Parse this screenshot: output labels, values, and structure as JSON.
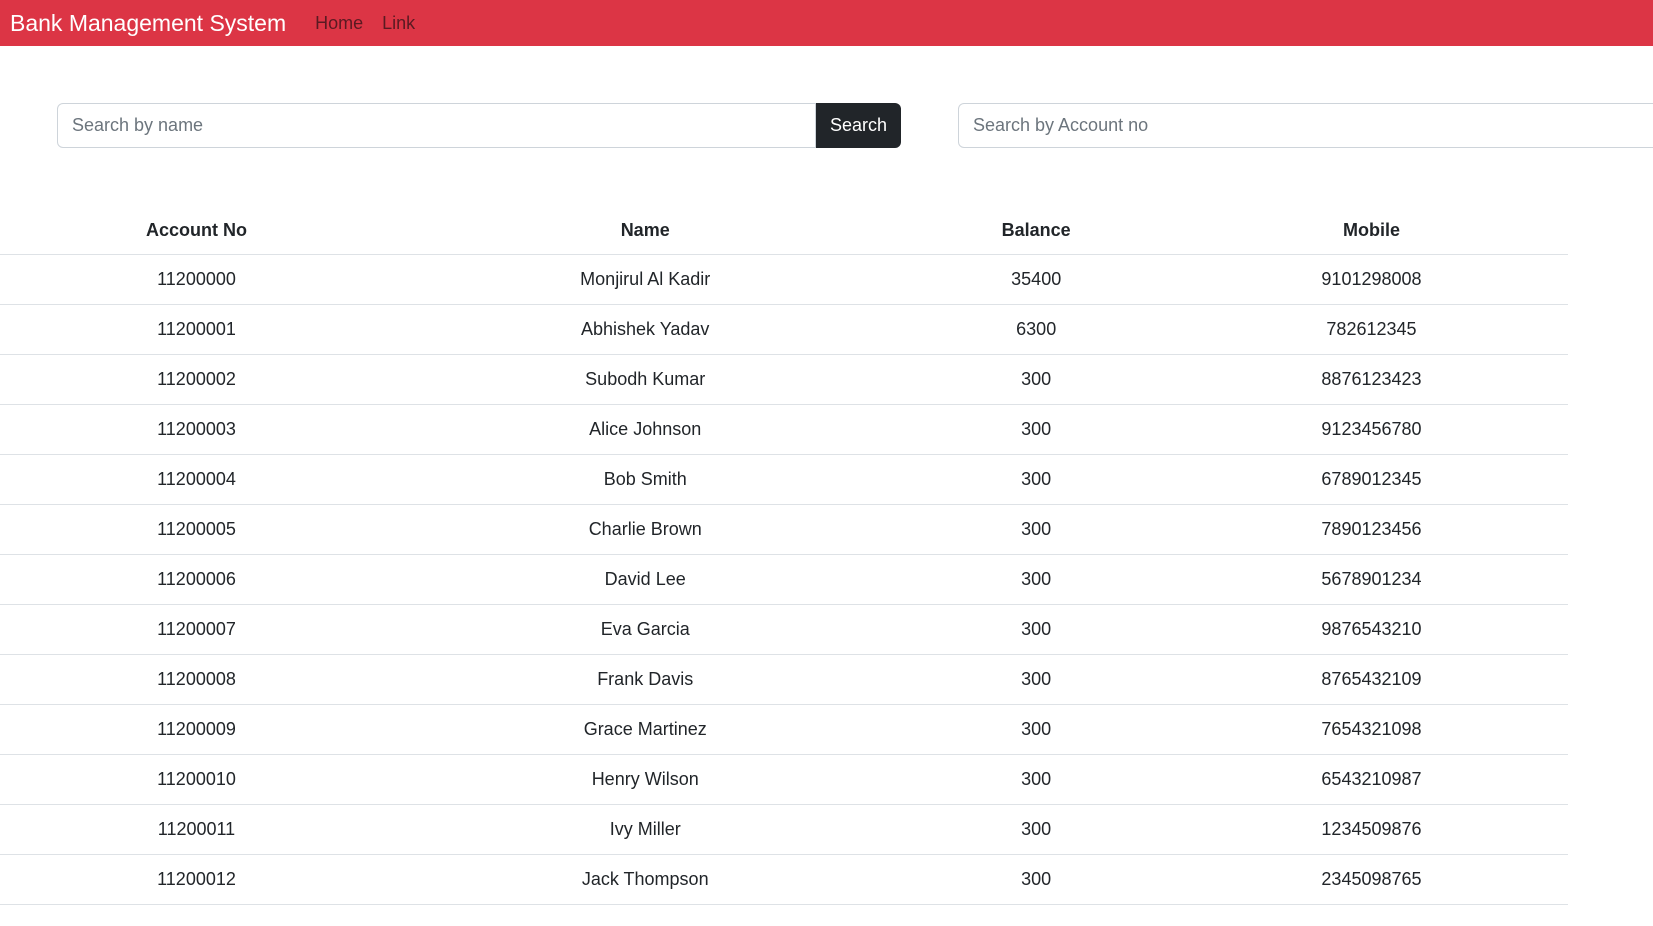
{
  "navbar": {
    "brand": "Bank Management System",
    "links": [
      {
        "label": "Home"
      },
      {
        "label": "Link"
      }
    ],
    "bg_color": "#dc3545"
  },
  "search_by_name": {
    "placeholder": "Search by name",
    "value": "",
    "button_label": "Search"
  },
  "search_by_account": {
    "placeholder": "Search by Account no",
    "value": ""
  },
  "table": {
    "columns": [
      "Account No",
      "Name",
      "Balance",
      "Mobile"
    ],
    "rows": [
      [
        "11200000",
        "Monjirul Al Kadir",
        "35400",
        "9101298008"
      ],
      [
        "11200001",
        "Abhishek Yadav",
        "6300",
        "782612345"
      ],
      [
        "11200002",
        "Subodh Kumar",
        "300",
        "8876123423"
      ],
      [
        "11200003",
        "Alice Johnson",
        "300",
        "9123456780"
      ],
      [
        "11200004",
        "Bob Smith",
        "300",
        "6789012345"
      ],
      [
        "11200005",
        "Charlie Brown",
        "300",
        "7890123456"
      ],
      [
        "11200006",
        "David Lee",
        "300",
        "5678901234"
      ],
      [
        "11200007",
        "Eva Garcia",
        "300",
        "9876543210"
      ],
      [
        "11200008",
        "Frank Davis",
        "300",
        "8765432109"
      ],
      [
        "11200009",
        "Grace Martinez",
        "300",
        "7654321098"
      ],
      [
        "11200010",
        "Henry Wilson",
        "300",
        "6543210987"
      ],
      [
        "11200011",
        "Ivy Miller",
        "300",
        "1234509876"
      ],
      [
        "11200012",
        "Jack Thompson",
        "300",
        "2345098765"
      ]
    ]
  }
}
